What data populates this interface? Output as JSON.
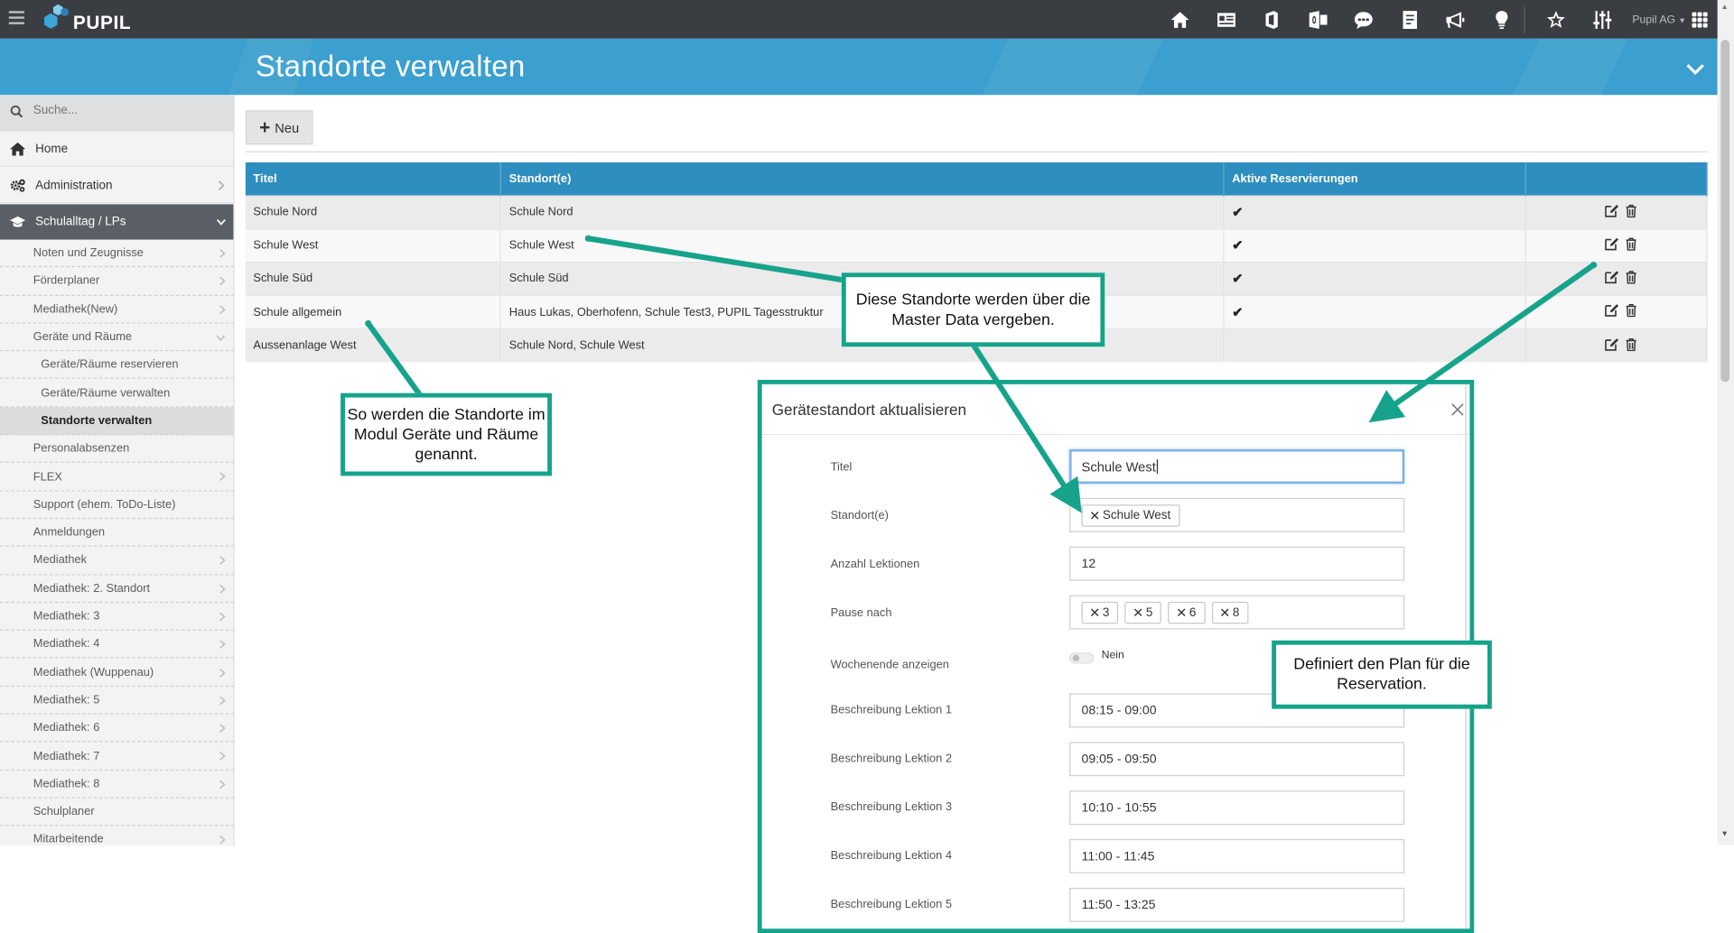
{
  "app": {
    "brand": "PUPIL",
    "company": "Pupil AG"
  },
  "topbar": {
    "icons": [
      "home-icon",
      "id-card-icon",
      "office-icon",
      "outlook-icon",
      "chat-icon",
      "document-icon",
      "megaphone-icon",
      "lightbulb-icon",
      "star-icon",
      "sliders-icon"
    ]
  },
  "header": {
    "title": "Standorte verwalten"
  },
  "sidebar": {
    "search_placeholder": "Suche...",
    "main": [
      {
        "label": "Home"
      },
      {
        "label": "Administration"
      },
      {
        "label": "Schulalltag / LPs"
      }
    ],
    "items": [
      {
        "label": "Noten und Zeugnisse"
      },
      {
        "label": "Förderplaner"
      },
      {
        "label": "Mediathek(New)"
      },
      {
        "label": "Geräte und Räume"
      },
      {
        "label": "Geräte/Räume reservieren"
      },
      {
        "label": "Geräte/Räume verwalten"
      },
      {
        "label": "Standorte verwalten"
      },
      {
        "label": "Personalabsenzen"
      },
      {
        "label": "FLEX"
      },
      {
        "label": "Support (ehem. ToDo-Liste)"
      },
      {
        "label": "Anmeldungen"
      },
      {
        "label": "Mediathek"
      },
      {
        "label": "Mediathek: 2. Standort"
      },
      {
        "label": "Mediathek: 3"
      },
      {
        "label": "Mediathek: 4"
      },
      {
        "label": "Mediathek (Wuppenau)"
      },
      {
        "label": "Mediathek: 5"
      },
      {
        "label": "Mediathek: 6"
      },
      {
        "label": "Mediathek: 7"
      },
      {
        "label": "Mediathek: 8"
      },
      {
        "label": "Schulplaner"
      },
      {
        "label": "Mitarbeitende"
      }
    ]
  },
  "toolbar": {
    "new_label": "Neu"
  },
  "table": {
    "headers": [
      "Titel",
      "Standort(e)",
      "Aktive Reservierungen",
      ""
    ],
    "rows": [
      {
        "titel": "Schule Nord",
        "standorte": "Schule Nord",
        "aktiv": true
      },
      {
        "titel": "Schule West",
        "standorte": "Schule West",
        "aktiv": true
      },
      {
        "titel": "Schule Süd",
        "standorte": "Schule Süd",
        "aktiv": true
      },
      {
        "titel": "Schule allgemein",
        "standorte": "Haus Lukas, Oberhofenn, Schule Test3, PUPIL Tagesstruktur",
        "aktiv": true
      },
      {
        "titel": "Aussenanlage West",
        "standorte": "Schule Nord, Schule West",
        "aktiv": false
      }
    ]
  },
  "modal": {
    "title": "Gerätestandort aktualisieren",
    "labels": {
      "titel": "Titel",
      "standorte": "Standort(e)",
      "lektionen": "Anzahl Lektionen",
      "pause": "Pause nach",
      "wochenende": "Wochenende anzeigen",
      "l1": "Beschreibung Lektion 1",
      "l2": "Beschreibung Lektion 2",
      "l3": "Beschreibung Lektion 3",
      "l4": "Beschreibung Lektion 4",
      "l5": "Beschreibung Lektion 5"
    },
    "values": {
      "titel": "Schule West",
      "standort_tag": "Schule West",
      "lektionen": "12",
      "pause_tags": [
        "3",
        "5",
        "6",
        "8"
      ],
      "wochenende": "Nein",
      "l1": "08:15 - 09:00",
      "l2": "09:05 - 09:50",
      "l3": "10:10 - 10:55",
      "l4": "11:00 - 11:45",
      "l5": "11:50 - 13:25"
    }
  },
  "callouts": {
    "master_data": "Diese Standorte werden über die Master Data vergeben.",
    "module_naming": "So werden die Standorte im Modul Geräte und Räume genannt.",
    "plan": "Definiert den Plan für die Reservation."
  },
  "colors": {
    "topbar": "#3a3e43",
    "header": "#3b9fcf",
    "table_header": "#2f8ec0",
    "callout_border": "#17a38b"
  }
}
